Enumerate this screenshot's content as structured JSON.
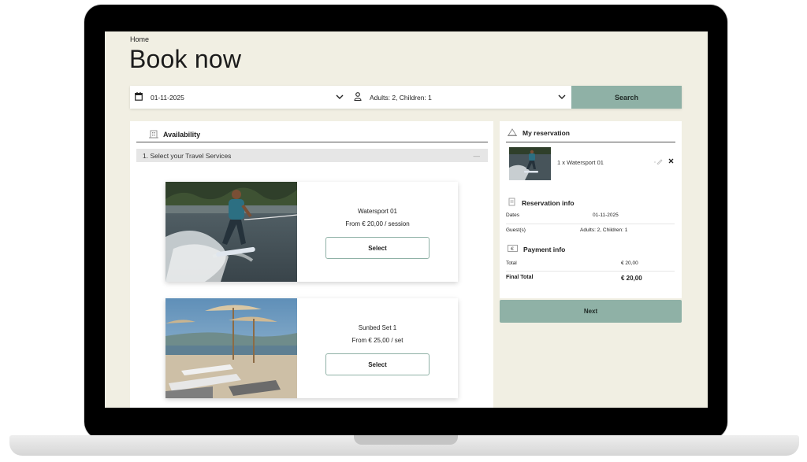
{
  "header": {
    "breadcrumb": "Home",
    "title": "Book now"
  },
  "search": {
    "date_value": "01-11-2025",
    "guests_value": "Adults: 2, Children: 1",
    "button_label": "Search"
  },
  "availability": {
    "title": "Availability",
    "step_label": "1.  Select your Travel Services",
    "step_collapse": "—",
    "cards": [
      {
        "name": "Watersport 01",
        "price": "From € 20,00 / session",
        "select_label": "Select"
      },
      {
        "name": "Sunbed Set 1",
        "price": "From € 25,00 / set",
        "select_label": "Select"
      }
    ]
  },
  "reservation": {
    "title": "My reservation",
    "item_text": "1 x  Watersport 01",
    "reservation_info_title": "Reservation info",
    "dates_label": "Dates",
    "dates_value": "01-11-2025",
    "guests_label": "Guest(s)",
    "guests_value": "Adults: 2, Children: 1",
    "payment_info_title": "Payment info",
    "total_label": "Total",
    "total_value": "€  20,00",
    "final_total_label": "Final Total",
    "final_total_value": "€  20,00",
    "next_label": "Next"
  },
  "colors": {
    "accent": "#8fb1a6",
    "page_background": "#f1efe3",
    "frame": "#000000"
  },
  "icons": {
    "date": "calendar-icon",
    "guests": "person-icon",
    "dropdown": "chevron-down-icon",
    "availability": "hotel-icon",
    "reservation": "reservation-icon",
    "reservation_info": "info-document-icon",
    "payment": "euro-icon",
    "edit": "pencil-icon",
    "remove": "close-icon"
  }
}
